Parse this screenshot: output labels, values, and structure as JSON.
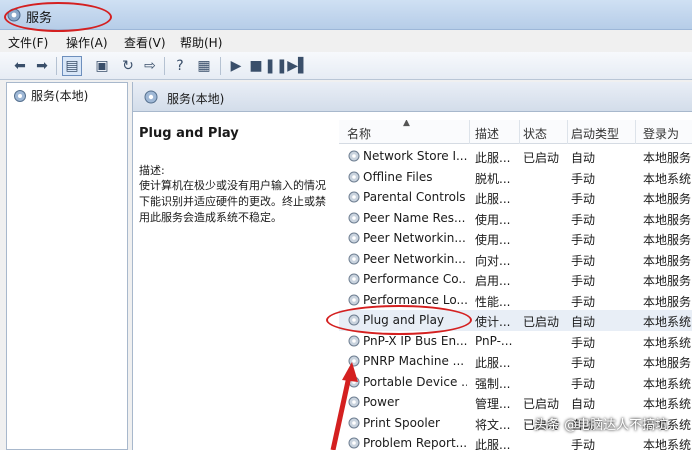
{
  "window": {
    "title": "服务"
  },
  "menu": [
    "文件(F)",
    "操作(A)",
    "查看(V)",
    "帮助(H)"
  ],
  "tree": {
    "item": "服务(本地)"
  },
  "main_header": "服务(本地)",
  "detail": {
    "service_name": "Plug and Play",
    "desc_label": "描述:",
    "description": "使计算机在极少或没有用户输入的情况下能识别并适应硬件的更改。终止或禁用此服务会造成系统不稳定。"
  },
  "columns": [
    "名称",
    "描述",
    "状态",
    "启动类型",
    "登录为"
  ],
  "rows": [
    {
      "name": "Network Store I...",
      "desc": "此服...",
      "status": "已启动",
      "startup": "自动",
      "logon": "本地服务"
    },
    {
      "name": "Offline Files",
      "desc": "脱机...",
      "status": "",
      "startup": "手动",
      "logon": "本地系统"
    },
    {
      "name": "Parental Controls",
      "desc": "此服...",
      "status": "",
      "startup": "手动",
      "logon": "本地服务"
    },
    {
      "name": "Peer Name Res...",
      "desc": "使用...",
      "status": "",
      "startup": "手动",
      "logon": "本地服务"
    },
    {
      "name": "Peer Networkin...",
      "desc": "使用...",
      "status": "",
      "startup": "手动",
      "logon": "本地服务"
    },
    {
      "name": "Peer Networkin...",
      "desc": "向对...",
      "status": "",
      "startup": "手动",
      "logon": "本地服务"
    },
    {
      "name": "Performance Co...",
      "desc": "启用...",
      "status": "",
      "startup": "手动",
      "logon": "本地服务"
    },
    {
      "name": "Performance Lo...",
      "desc": "性能...",
      "status": "",
      "startup": "手动",
      "logon": "本地服务"
    },
    {
      "name": "Plug and Play",
      "desc": "使计...",
      "status": "已启动",
      "startup": "自动",
      "logon": "本地系统"
    },
    {
      "name": "PnP-X IP Bus En...",
      "desc": "PnP-...",
      "status": "",
      "startup": "手动",
      "logon": "本地系统"
    },
    {
      "name": "PNRP Machine ...",
      "desc": "此服...",
      "status": "",
      "startup": "手动",
      "logon": "本地服务"
    },
    {
      "name": "Portable Device ...",
      "desc": "强制...",
      "status": "",
      "startup": "手动",
      "logon": "本地系统"
    },
    {
      "name": "Power",
      "desc": "管理...",
      "status": "已启动",
      "startup": "自动",
      "logon": "本地系统"
    },
    {
      "name": "Print Spooler",
      "desc": "将文...",
      "status": "已启动",
      "startup": "自动",
      "logon": "本地系统"
    },
    {
      "name": "Problem Report...",
      "desc": "此服...",
      "status": "",
      "startup": "手动",
      "logon": "本地系统"
    }
  ],
  "watermark": "头条 @电脑达人不搞坑",
  "colors": {
    "highlight": "#d42020",
    "titlebar": "#c4d8ef",
    "selected_row": "#e8eef6"
  },
  "icons": [
    "services-icon",
    "back-icon",
    "forward-icon",
    "show-hide-tree-icon",
    "properties-icon",
    "refresh-icon",
    "export-icon",
    "help-icon",
    "view-icon",
    "start-icon",
    "stop-icon",
    "pause-icon",
    "restart-icon",
    "gear-icon"
  ]
}
